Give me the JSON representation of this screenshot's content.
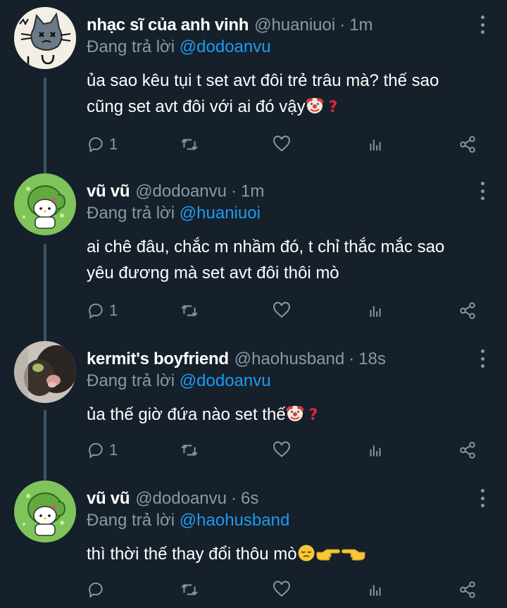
{
  "tweets": [
    {
      "name": "nhạc sĩ của anh vinh",
      "handle": "@huaniuoi",
      "time": "1m",
      "reply_prefix": "Đang trả lời",
      "reply_to": "@dodoanvu",
      "text_line1": "ủa sao kêu tụi t set avt đôi trẻ trâu mà? thế sao",
      "text_line2": "cũng set avt đôi với ai đó vậy",
      "reply_count": "1",
      "avatar_icon": "cat-doodle-avatar"
    },
    {
      "name": "vũ vũ",
      "handle": "@dodoanvu",
      "time": "1m",
      "reply_prefix": "Đang trả lời",
      "reply_to": "@huaniuoi",
      "text_line1": "ai chê đâu, chắc m nhầm đó, t chỉ thắc mắc sao",
      "text_line2": "yêu đương mà set avt đôi thôi mò",
      "reply_count": "1",
      "avatar_icon": "hello-kitty-frog-avatar"
    },
    {
      "name": "kermit's boyfriend",
      "handle": "@haohusband",
      "time": "18s",
      "reply_prefix": "Đang trả lời",
      "reply_to": "@dodoanvu",
      "text_line1": "ủa thế giờ đứa nào set thế",
      "reply_count": "1",
      "avatar_icon": "cat-photo-avatar"
    },
    {
      "name": "vũ vũ",
      "handle": "@dodoanvu",
      "time": "6s",
      "reply_prefix": "Đang trả lời",
      "reply_to": "@haohusband",
      "text_line1": "thì thời thế thay đổi thôu mò",
      "reply_count": "",
      "avatar_icon": "hello-kitty-frog-avatar"
    }
  ],
  "colors": {
    "background": "#15202b",
    "secondary_text": "#8899a6",
    "mention": "#1d9bf0",
    "thread_line": "#3d5466"
  }
}
